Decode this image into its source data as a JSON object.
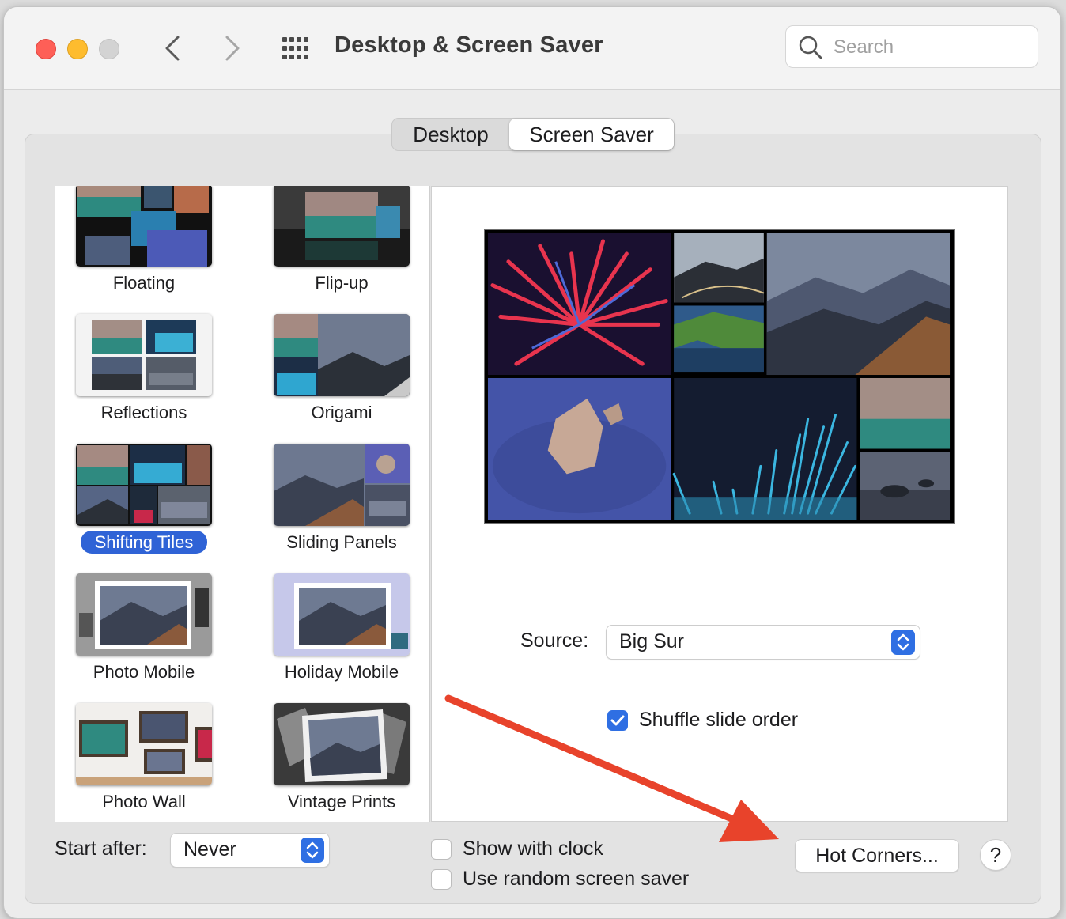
{
  "window": {
    "title": "Desktop & Screen Saver",
    "search_placeholder": "Search"
  },
  "tabs": [
    {
      "label": "Desktop",
      "selected": false
    },
    {
      "label": "Screen Saver",
      "selected": true
    }
  ],
  "savers": [
    {
      "label": "Floating",
      "selected": false
    },
    {
      "label": "Flip-up",
      "selected": false
    },
    {
      "label": "Reflections",
      "selected": false
    },
    {
      "label": "Origami",
      "selected": false
    },
    {
      "label": "Shifting Tiles",
      "selected": true
    },
    {
      "label": "Sliding Panels",
      "selected": false
    },
    {
      "label": "Photo Mobile",
      "selected": false
    },
    {
      "label": "Holiday Mobile",
      "selected": false
    },
    {
      "label": "Photo Wall",
      "selected": false
    },
    {
      "label": "Vintage Prints",
      "selected": false
    }
  ],
  "options": {
    "source_label": "Source:",
    "source_value": "Big Sur",
    "shuffle_label": "Shuffle slide order",
    "shuffle_checked": true
  },
  "footer": {
    "start_after_label": "Start after:",
    "start_after_value": "Never",
    "show_clock_label": "Show with clock",
    "show_clock_checked": false,
    "random_label": "Use random screen saver",
    "random_checked": false,
    "hot_corners_label": "Hot Corners...",
    "help_label": "?"
  },
  "colors": {
    "accent": "#2f63d6",
    "annotation_arrow": "#e8432b"
  }
}
